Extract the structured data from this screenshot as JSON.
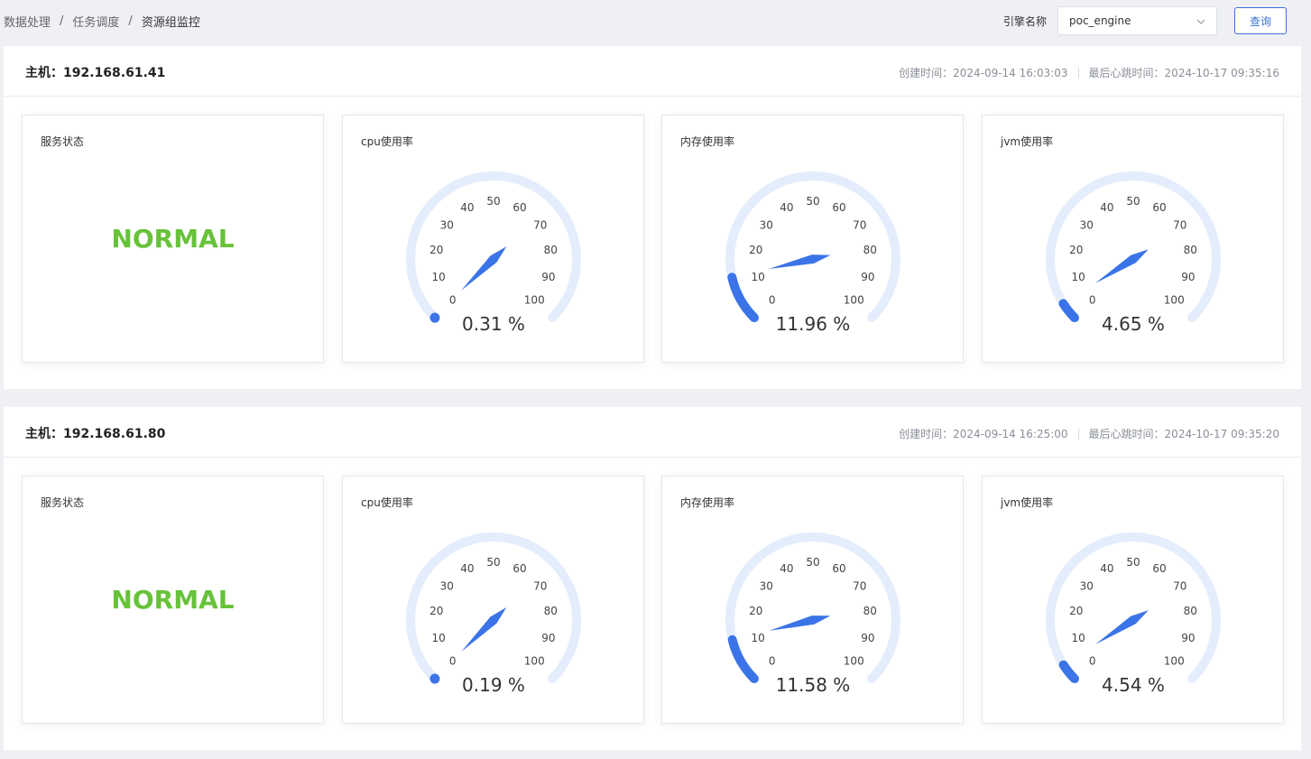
{
  "breadcrumb": {
    "items": [
      "数据处理",
      "任务调度",
      "资源组监控"
    ],
    "separator": "/"
  },
  "filter": {
    "engine_label": "引擎名称",
    "engine_value": "poc_engine",
    "query_label": "查询"
  },
  "colors": {
    "accent": "#3a6fd8",
    "gauge_track": "#e3edfb",
    "gauge_fill": "#3b74e8",
    "status_normal": "#67c23a"
  },
  "icons": {
    "select_arrow": "chevron-down-icon"
  },
  "hosts": [
    {
      "title": "主机：192.168.61.41",
      "created_label": "创建时间：",
      "created": "2024-09-14 16:03:03",
      "heartbeat_label": "最后心跳时间：",
      "heartbeat": "2024-10-17 09:35:16",
      "status": {
        "title": "服务状态",
        "value": "NORMAL"
      },
      "gauges": [
        {
          "title": "cpu使用率",
          "value": 0.31,
          "display": "0.31 %"
        },
        {
          "title": "内存使用率",
          "value": 11.96,
          "display": "11.96 %"
        },
        {
          "title": "jvm使用率",
          "value": 4.65,
          "display": "4.65 %"
        }
      ]
    },
    {
      "title": "主机：192.168.61.80",
      "created_label": "创建时间：",
      "created": "2024-09-14 16:25:00",
      "heartbeat_label": "最后心跳时间：",
      "heartbeat": "2024-10-17 09:35:20",
      "status": {
        "title": "服务状态",
        "value": "NORMAL"
      },
      "gauges": [
        {
          "title": "cpu使用率",
          "value": 0.19,
          "display": "0.19 %"
        },
        {
          "title": "内存使用率",
          "value": 11.58,
          "display": "11.58 %"
        },
        {
          "title": "jvm使用率",
          "value": 4.54,
          "display": "4.54 %"
        }
      ]
    }
  ],
  "gauge_scale": {
    "min": 0,
    "max": 100,
    "ticks": [
      "0",
      "10",
      "20",
      "30",
      "40",
      "50",
      "60",
      "70",
      "80",
      "90",
      "100"
    ]
  }
}
